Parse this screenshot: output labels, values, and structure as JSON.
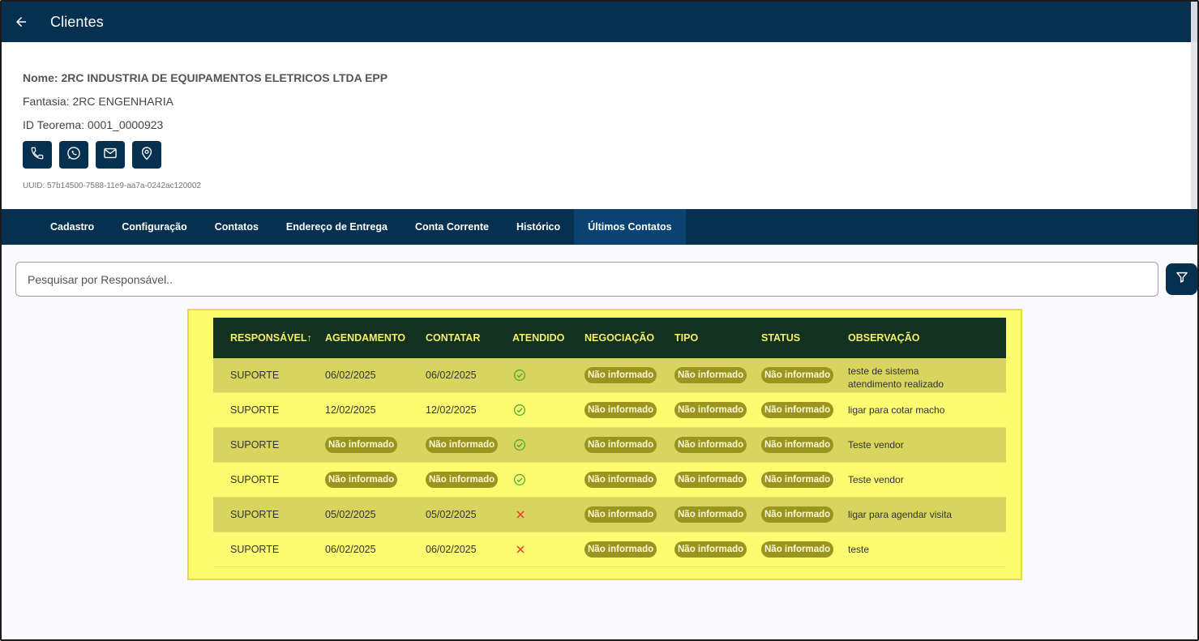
{
  "appbar": {
    "title": "Clientes"
  },
  "client": {
    "name": "Nome: 2RC INDUSTRIA DE EQUIPAMENTOS ELETRICOS LTDA EPP",
    "fantasia": "Fantasia: 2RC ENGENHARIA",
    "id_teorema": "ID Teorema:  0001_0000923",
    "uuid": "UUID: 57b14500-7588-11e9-aa7a-0242ac120002"
  },
  "actions": [
    {
      "icon": "phone-icon"
    },
    {
      "icon": "whatsapp-icon"
    },
    {
      "icon": "mail-icon"
    },
    {
      "icon": "location-pin-icon"
    }
  ],
  "tabs": [
    {
      "label": "Cadastro",
      "active": false
    },
    {
      "label": "Configuração",
      "active": false
    },
    {
      "label": "Contatos",
      "active": false
    },
    {
      "label": "Endereço de Entrega",
      "active": false
    },
    {
      "label": "Conta Corrente",
      "active": false
    },
    {
      "label": "Histórico",
      "active": false
    },
    {
      "label": "Últimos Contatos",
      "active": true
    }
  ],
  "search": {
    "placeholder": "Pesquisar por Responsável..",
    "value": ""
  },
  "table": {
    "headers": [
      "RESPONSÁVEL",
      "AGENDAMENTO",
      "CONTATAR",
      "ATENDIDO",
      "NEGOCIAÇÃO",
      "TIPO",
      "STATUS",
      "OBSERVAÇÃO"
    ],
    "sort_indicator": "↑",
    "rows": [
      {
        "responsavel": "SUPORTE",
        "agendamento": "06/02/2025",
        "contatar": "06/02/2025",
        "atendido": true,
        "negociacao": "Não informado",
        "tipo": "Não informado",
        "status": "Não informado",
        "observacao": "teste de sistema atendimento realizado"
      },
      {
        "responsavel": "SUPORTE",
        "agendamento": "12/02/2025",
        "contatar": "12/02/2025",
        "atendido": true,
        "negociacao": "Não informado",
        "tipo": "Não informado",
        "status": "Não informado",
        "observacao": "ligar para cotar macho"
      },
      {
        "responsavel": "SUPORTE",
        "agendamento": "Não informado",
        "contatar": "Não informado",
        "atendido": true,
        "negociacao": "Não informado",
        "tipo": "Não informado",
        "status": "Não informado",
        "observacao": "Teste vendor"
      },
      {
        "responsavel": "SUPORTE",
        "agendamento": "Não informado",
        "contatar": "Não informado",
        "atendido": true,
        "negociacao": "Não informado",
        "tipo": "Não informado",
        "status": "Não informado",
        "observacao": "Teste vendor"
      },
      {
        "responsavel": "SUPORTE",
        "agendamento": "05/02/2025",
        "contatar": "05/02/2025",
        "atendido": false,
        "negociacao": "Não informado",
        "tipo": "Não informado",
        "status": "Não informado",
        "observacao": "ligar para agendar visita"
      },
      {
        "responsavel": "SUPORTE",
        "agendamento": "06/02/2025",
        "contatar": "06/02/2025",
        "atendido": false,
        "negociacao": "Não informado",
        "tipo": "Não informado",
        "status": "Não informado",
        "observacao": "teste"
      }
    ]
  },
  "colors": {
    "primary": "#05304f",
    "active_tab": "#0a4272",
    "table_header_bg": "#12321f",
    "table_header_text": "#f3ee6c",
    "highlight": "#fcfb6e",
    "pill": "#9b9520",
    "check": "#3ea83a",
    "cross": "#e53935"
  }
}
